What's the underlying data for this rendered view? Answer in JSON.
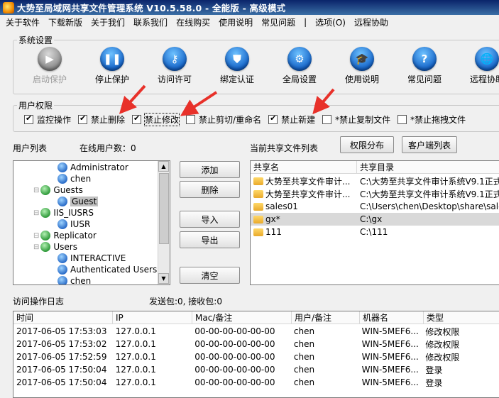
{
  "title": "大势至局域网共享文件管理系统 V10.5.58.0 - 全能版 - 高级模式",
  "menu": [
    "关于软件",
    "下载新版",
    "关于我们",
    "联系我们",
    "在线购买",
    "使用说明",
    "常见问题",
    "|",
    "选项(O)",
    "远程协助"
  ],
  "system_settings": {
    "label": "系统设置",
    "buttons": [
      {
        "label": "启动保护",
        "icon": "play-icon",
        "glyph": "▶",
        "disabled": true
      },
      {
        "label": "停止保护",
        "icon": "pause-icon",
        "glyph": "❚❚",
        "disabled": false
      },
      {
        "label": "访问许可",
        "icon": "key-icon",
        "glyph": "⚷",
        "disabled": false
      },
      {
        "label": "绑定认证",
        "icon": "shield-icon",
        "glyph": "⛊",
        "disabled": false
      },
      {
        "label": "全局设置",
        "icon": "gear-icon",
        "glyph": "⚙",
        "disabled": false
      },
      {
        "label": "使用说明",
        "icon": "graduation-cap-icon",
        "glyph": "🎓",
        "disabled": false
      },
      {
        "label": "常见问题",
        "icon": "question-icon",
        "glyph": "?",
        "disabled": false
      },
      {
        "label": "远程协助",
        "icon": "globe-icon",
        "glyph": "🌐",
        "disabled": false
      }
    ]
  },
  "user_permissions": {
    "label": "用户权限",
    "items": [
      {
        "label": "监控操作",
        "checked": true
      },
      {
        "label": "禁止删除",
        "checked": true
      },
      {
        "label": "禁止修改",
        "checked": true
      },
      {
        "label": "禁止剪切/重命名",
        "checked": false
      },
      {
        "label": "禁止新建",
        "checked": true
      },
      {
        "label": "*禁止复制文件",
        "checked": false
      },
      {
        "label": "*禁止拖拽文件",
        "checked": false
      }
    ]
  },
  "user_list": {
    "label": "用户列表",
    "online_label": "在线用户数：",
    "online_count": "0",
    "items": [
      {
        "text": "Administrator",
        "type": "user",
        "level": 2
      },
      {
        "text": "chen",
        "type": "user",
        "level": 2
      },
      {
        "text": "Guests",
        "type": "group",
        "level": 1
      },
      {
        "text": "Guest",
        "type": "user",
        "level": 2,
        "selected": true
      },
      {
        "text": "IIS_IUSRS",
        "type": "group",
        "level": 1
      },
      {
        "text": "IUSR",
        "type": "user",
        "level": 2
      },
      {
        "text": "Replicator",
        "type": "group",
        "level": 1
      },
      {
        "text": "Users",
        "type": "group",
        "level": 1
      },
      {
        "text": "INTERACTIVE",
        "type": "user",
        "level": 2
      },
      {
        "text": "Authenticated Users",
        "type": "user",
        "level": 2
      },
      {
        "text": "chen",
        "type": "user",
        "level": 2
      }
    ]
  },
  "action_buttons": {
    "add": "添加",
    "delete": "删除",
    "import": "导入",
    "export": "导出",
    "clear": "清空"
  },
  "shared_files": {
    "label": "当前共享文件列表",
    "btn_perm": "权限分布",
    "btn_clients": "客户端列表",
    "columns": [
      "共享名",
      "共享目录"
    ],
    "rows": [
      {
        "name": "大势至共享文件审计...",
        "path": "C:\\大势至共享文件审计系统V9.1正式"
      },
      {
        "name": "大势至共享文件审计...",
        "path": "C:\\大势至共享文件审计系统V9.1正式"
      },
      {
        "name": "sales01",
        "path": "C:\\Users\\chen\\Desktop\\share\\sales\\"
      },
      {
        "name": "gx*",
        "path": "C:\\gx",
        "highlight": true
      },
      {
        "name": "111",
        "path": "C:\\111"
      }
    ]
  },
  "log": {
    "label": "访问操作日志",
    "packets": "发送包:0, 接收包:0",
    "columns": [
      "时间",
      "IP",
      "Mac/备注",
      "用户/备注",
      "机器名",
      "类型"
    ],
    "rows": [
      [
        "2017-06-05 17:53:03",
        "127.0.0.1",
        "00-00-00-00-00-00",
        "chen",
        "WIN-5MEF6...",
        "修改权限"
      ],
      [
        "2017-06-05 17:53:02",
        "127.0.0.1",
        "00-00-00-00-00-00",
        "chen",
        "WIN-5MEF6...",
        "修改权限"
      ],
      [
        "2017-06-05 17:52:59",
        "127.0.0.1",
        "00-00-00-00-00-00",
        "chen",
        "WIN-5MEF6...",
        "修改权限"
      ],
      [
        "2017-06-05 17:50:04",
        "127.0.0.1",
        "00-00-00-00-00-00",
        "chen",
        "WIN-5MEF6...",
        "登录"
      ],
      [
        "2017-06-05 17:50:04",
        "127.0.0.1",
        "00-00-00-00-00-00",
        "chen",
        "WIN-5MEF6...",
        "登录"
      ]
    ]
  },
  "colors": {
    "annotation_arrow": "#e8312a",
    "accent": "#1463c8"
  }
}
